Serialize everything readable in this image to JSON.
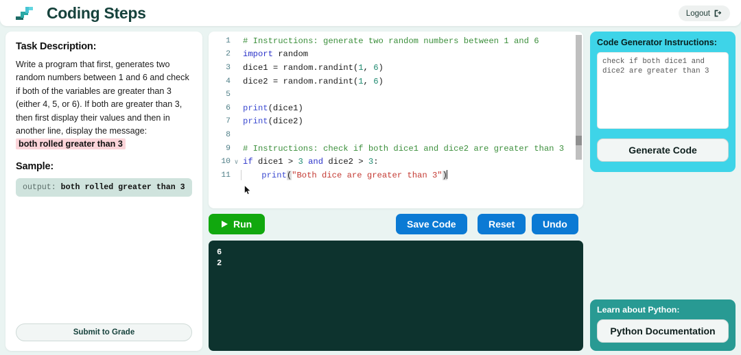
{
  "header": {
    "title": "Coding Steps",
    "logo_icon": "steps-logo-icon",
    "logout_label": "Logout",
    "logout_icon": "sign-out-icon"
  },
  "left_panel": {
    "task_heading": "Task Description:",
    "task_text_1": "Write a program that first, generates two random numbers between 1 and 6 and check if both of the variables are greater than 3 (either 4, 5, or 6). If both are greater than 3, then first display their values and then in another line, display the message: ",
    "task_highlight": "both rolled greater than 3",
    "sample_heading": "Sample:",
    "sample_label": "output: ",
    "sample_value": "both rolled greater than 3",
    "submit_label": "Submit to Grade"
  },
  "editor": {
    "lines": [
      {
        "n": "1",
        "fold": "",
        "indent": false
      },
      {
        "n": "2",
        "fold": "",
        "indent": false
      },
      {
        "n": "3",
        "fold": "",
        "indent": false
      },
      {
        "n": "4",
        "fold": "",
        "indent": false
      },
      {
        "n": "5",
        "fold": "",
        "indent": false
      },
      {
        "n": "6",
        "fold": "",
        "indent": false
      },
      {
        "n": "7",
        "fold": "",
        "indent": false
      },
      {
        "n": "8",
        "fold": "",
        "indent": false
      },
      {
        "n": "9",
        "fold": "",
        "indent": false
      },
      {
        "n": "10",
        "fold": "∨",
        "indent": false
      },
      {
        "n": "11",
        "fold": "",
        "indent": true
      }
    ],
    "line_numbers": {
      "l1": "1",
      "l2": "2",
      "l3": "3",
      "l4": "4",
      "l5": "5",
      "l6": "6",
      "l7": "7",
      "l8": "8",
      "l9": "9",
      "l10": "10",
      "l11": "11"
    },
    "fold_marker": "∨",
    "code": {
      "line1_comment": "# Instructions: generate two random numbers between 1 and 6",
      "line2_kw": "import",
      "line2_rest": " random",
      "line3_pre": "dice1 = random.randint(",
      "line3_n1": "1",
      "line3_mid": ", ",
      "line3_n2": "6",
      "line3_post": ")",
      "line4_pre": "dice2 = random.randint(",
      "line4_n1": "1",
      "line4_mid": ", ",
      "line4_n2": "6",
      "line4_post": ")",
      "line5": "",
      "line6_fn": "print",
      "line6_rest": "(dice1)",
      "line7_fn": "print",
      "line7_rest": "(dice2)",
      "line8": "",
      "line9_comment": "# Instructions: check if both dice1 and dice2 are greater than 3",
      "line10_if": "if",
      "line10_a": " dice1 > ",
      "line10_n1": "3",
      "line10_and": " and",
      "line10_b": " dice2 > ",
      "line10_n2": "3",
      "line10_end": ":",
      "line11_indent": "    ",
      "line11_fn": "print",
      "line11_open": "(",
      "line11_str": "\"Both dice are greater than 3\"",
      "line11_close": ")"
    }
  },
  "buttons": {
    "run_label": "Run",
    "run_icon": "play-icon",
    "save_label": "Save Code",
    "reset_label": "Reset",
    "undo_label": "Undo"
  },
  "console": {
    "output_line_1": "6",
    "output_line_2": "2"
  },
  "generator_panel": {
    "title": "Code Generator Instructions:",
    "textarea_value": "check if both dice1 and dice2 are greater than 3",
    "textarea_placeholder": "",
    "generate_label": "Generate Code"
  },
  "learn_panel": {
    "title": "Learn about Python:",
    "doc_label": "Python Documentation"
  },
  "colors": {
    "page_bg": "#eaf4f2",
    "accent_teal": "#289a93",
    "accent_cyan": "#3ed4e8",
    "run_green": "#11a80e",
    "action_blue": "#0b7ad4",
    "console_bg": "#0d332e",
    "highlight_pink": "#fbd5da",
    "sample_bg": "#cfe3dd"
  }
}
